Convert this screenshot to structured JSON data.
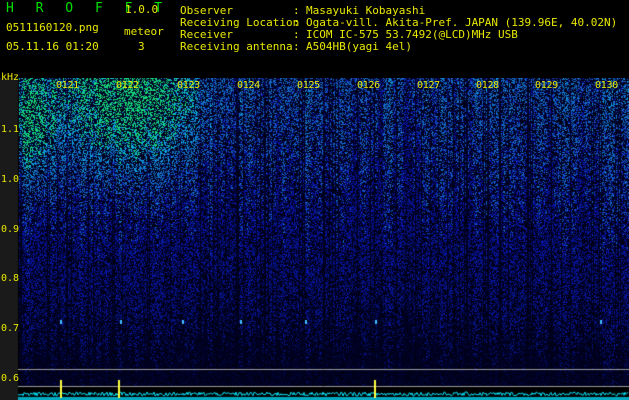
{
  "app": {
    "title": "H R O F F T",
    "version": "1.0.0",
    "filename": "0511160120.png",
    "datetime": "05.11.16 01:20",
    "meteor_label": "meteor",
    "meteor_count": "3"
  },
  "info": {
    "rows": [
      {
        "key": "Observer",
        "sep": ":",
        "value": "Masayuki Kobayashi"
      },
      {
        "key": "Receiving Location",
        "sep": ":",
        "value": "Ogata-vill. Akita-Pref. JAPAN (139.96E, 40.02N)"
      },
      {
        "key": "Receiver",
        "sep": ":",
        "value": "ICOM IC-575 53.7492(@LCD)MHz USB"
      },
      {
        "key": "Receiving antenna",
        "sep": ":",
        "value": "A504HB(yagi 4el)"
      }
    ]
  },
  "axes": {
    "y_unit": "kHz",
    "y_ticks": [
      "1.1",
      "1.0",
      "0.9",
      "0.8",
      "0.7",
      "0.6"
    ],
    "x_ticks": [
      "0121",
      "0122",
      "0123",
      "0124",
      "0125",
      "0126",
      "0127",
      "0128",
      "0129",
      "0130"
    ]
  },
  "colors": {
    "background": "#000000",
    "label_yellow": "#e8e800",
    "title_green": "#00e000",
    "signal_cyan": "#00e8ff",
    "spectrum_blue": "#1030c0"
  }
}
